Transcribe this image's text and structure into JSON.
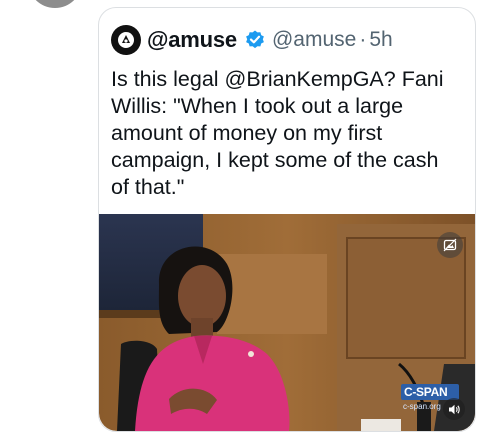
{
  "tweet": {
    "display_name": "@amuse",
    "handle": "@amuse",
    "separator": "·",
    "timestamp": "5h",
    "verified": true,
    "text_line1": "Is this legal @BrianKempGA? Fani",
    "text_line2": "Willis: \"When I took out a large",
    "text_line3": "amount of money on my first",
    "text_line4": "campaign, I kept some of the cash",
    "text_line5": "of that.\""
  },
  "media": {
    "logo_text": "C-SPAN",
    "logo_sub": "c-span.org",
    "icons": {
      "top_right": "picture-toggle-icon",
      "bottom_right": "speaker-icon"
    }
  },
  "colors": {
    "verified_blue": "#1d9bf0",
    "secondary_text": "#536471",
    "jacket_pink": "#d9327a"
  }
}
